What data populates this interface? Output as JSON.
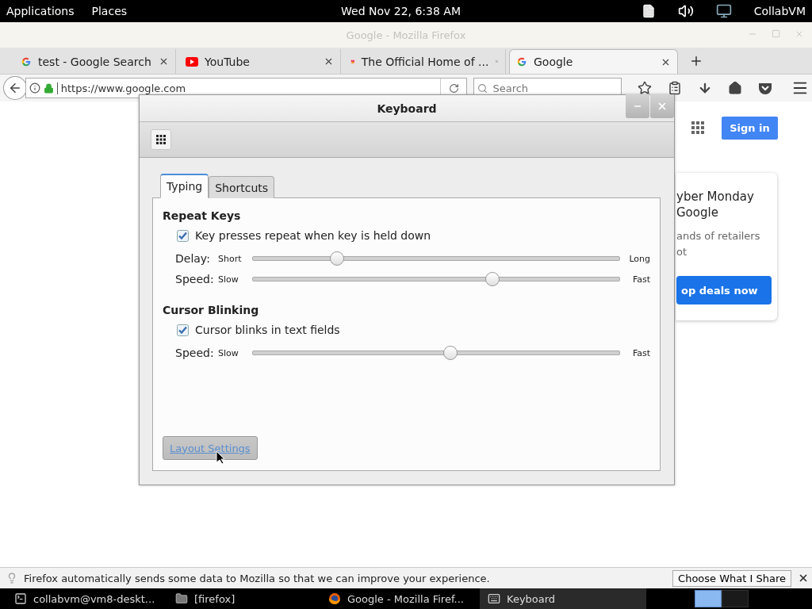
{
  "top_bar": {
    "menus": [
      "Applications",
      "Places"
    ],
    "clock": "Wed Nov 22, 6:38 AM",
    "user": "CollabVM"
  },
  "browser": {
    "title": "Google - Mozilla Firefox",
    "tabs": [
      {
        "title": "test - Google Search",
        "kind": "google",
        "selected": false
      },
      {
        "title": "YouTube",
        "kind": "youtube",
        "selected": false
      },
      {
        "title": "The Official Home of ...",
        "kind": "image",
        "selected": false
      },
      {
        "title": "Google",
        "kind": "google",
        "selected": true
      }
    ],
    "address": "https://www.google.com",
    "search": {
      "placeholder": "Search"
    },
    "page": {
      "sign_in": "Sign in",
      "promo": {
        "title": [
          "yber Monday",
          "Google"
        ],
        "body": [
          "ands of retailers",
          "ot"
        ],
        "button": "op deals now"
      }
    },
    "notification": {
      "text": "Firefox automatically sends some data to Mozilla so that we can improve your experience.",
      "button": "Choose What I Share"
    }
  },
  "dialog": {
    "title": "Keyboard",
    "tabs": [
      {
        "label": "Typing",
        "selected": true
      },
      {
        "label": "Shortcuts",
        "selected": false
      }
    ],
    "sections": [
      {
        "heading": "Repeat Keys",
        "checkbox": {
          "label": "Key presses repeat when key is held down",
          "checked": true
        },
        "sliders": [
          {
            "label": "Delay:",
            "min": "Short",
            "max": "Long",
            "level": 0.22
          },
          {
            "label": "Speed:",
            "min": "Slow",
            "max": "Fast",
            "level": 0.66
          }
        ]
      },
      {
        "heading": "Cursor Blinking",
        "checkbox": {
          "label": "Cursor blinks in text fields",
          "checked": true
        },
        "sliders": [
          {
            "label": "Speed:",
            "min": "Slow",
            "max": "Fast",
            "level": 0.54
          }
        ]
      }
    ],
    "button": "Layout Settings"
  },
  "taskbar": {
    "items": [
      {
        "label": "collabvm@vm8-deskt...",
        "kind": "terminal",
        "selected": false
      },
      {
        "label": "[firefox]",
        "kind": "folder",
        "selected": false
      },
      {
        "label": "Google - Mozilla Firef...",
        "kind": "firefox",
        "selected": false
      },
      {
        "label": "Keyboard",
        "kind": "keyboard",
        "selected": true
      }
    ],
    "workspaces": [
      {
        "selected": true
      },
      {
        "selected": false
      }
    ]
  }
}
